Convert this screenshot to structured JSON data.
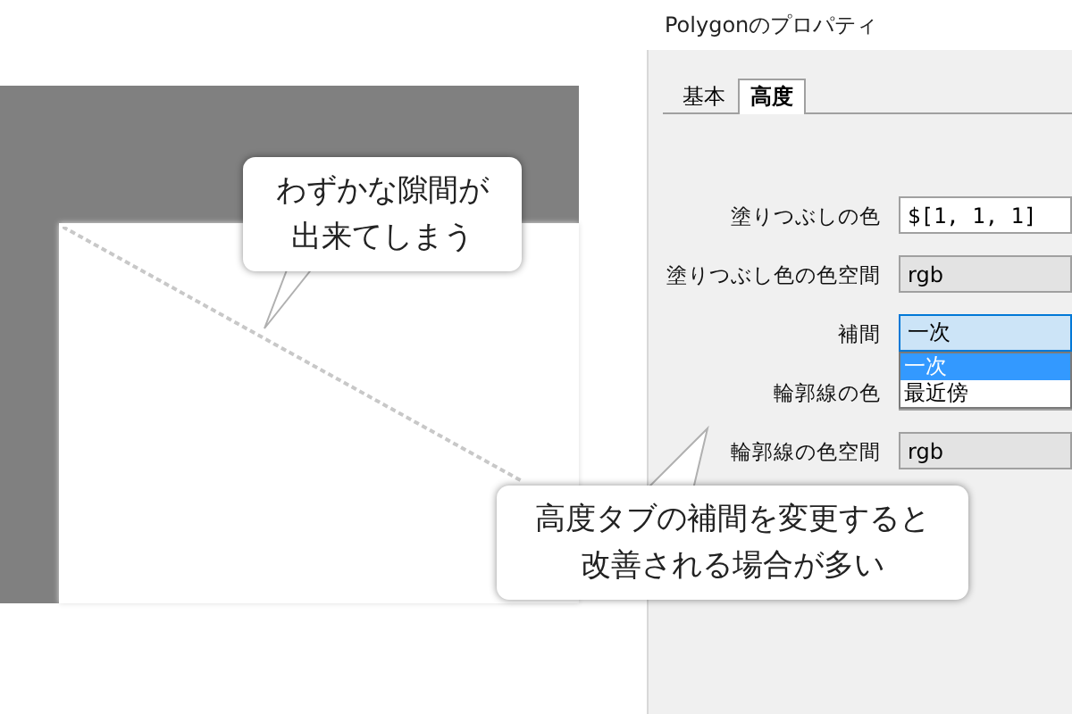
{
  "window": {
    "title": "Polygonのプロパティ"
  },
  "tabs": [
    {
      "label": "基本",
      "selected": false
    },
    {
      "label": "高度",
      "selected": true
    }
  ],
  "fields": [
    {
      "label": "塗りつぶしの色",
      "kind": "text",
      "value": "$[1, 1, 1]"
    },
    {
      "label": "塗りつぶし色の色空間",
      "kind": "readonly",
      "value": "rgb"
    },
    {
      "label": "補間",
      "kind": "select",
      "value": "一次",
      "expanded": true,
      "options": [
        {
          "label": "一次",
          "selected": true
        },
        {
          "label": "最近傍",
          "selected": false
        }
      ]
    },
    {
      "label": "輪郭線の色",
      "kind": "text"
    },
    {
      "label": "輪郭線の色空間",
      "kind": "readonly",
      "value": "rgb"
    }
  ],
  "callouts": [
    {
      "lines": [
        "わずかな隙間が",
        "出来てしまう"
      ]
    },
    {
      "lines": [
        "高度タブの補間を変更すると",
        "改善される場合が多い"
      ]
    }
  ]
}
